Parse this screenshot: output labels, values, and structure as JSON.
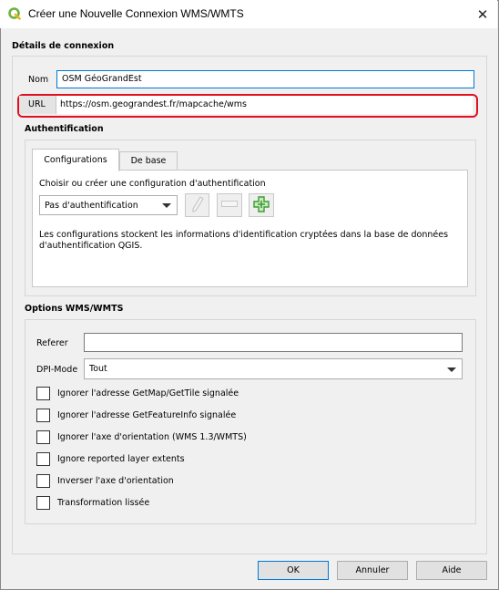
{
  "window": {
    "title": "Créer une Nouvelle Connexion WMS/WMTS",
    "app_icon": "qgis-logo-icon",
    "close_glyph": "✕"
  },
  "details": {
    "heading": "Détails de connexion",
    "name_label": "Nom",
    "name_value": "OSM GéoGrandEst",
    "url_label": "URL",
    "url_value": "https://osm.geograndest.fr/mapcache/wms"
  },
  "auth": {
    "heading": "Authentification",
    "tabs": [
      {
        "label": "Configurations",
        "active": true
      },
      {
        "label": "De base",
        "active": false
      }
    ],
    "choose_label": "Choisir ou créer une configuration d'authentification",
    "selected_config": "Pas d'authentification",
    "tool_icons": [
      "edit-pencil-icon",
      "remove-minus-icon",
      "add-plus-icon"
    ],
    "info_line1": "Les configurations stockent les informations d'identification cryptées dans la base de données",
    "info_line2": "d'authentification QGIS."
  },
  "options": {
    "heading": "Options WMS/WMTS",
    "referer_label": "Referer",
    "referer_value": "",
    "dpi_label": "DPI-Mode",
    "dpi_value": "Tout",
    "checkboxes": [
      {
        "label": "Ignorer l'adresse GetMap/GetTile signalée",
        "checked": false
      },
      {
        "label": "Ignorer l'adresse GetFeatureInfo signalée",
        "checked": false
      },
      {
        "label": "Ignorer l'axe d'orientation (WMS 1.3/WMTS)",
        "checked": false
      },
      {
        "label": "Ignore reported layer extents",
        "checked": false
      },
      {
        "label": "Inverser l'axe d'orientation",
        "checked": false
      },
      {
        "label": "Transformation lissée",
        "checked": false
      }
    ]
  },
  "buttons": {
    "ok": "OK",
    "cancel": "Annuler",
    "help": "Aide"
  },
  "colors": {
    "url_highlight": "#e01020",
    "focus_border": "#0078d7",
    "qgis_green": "#6cb33f",
    "plus_green": "#3d9b35"
  }
}
